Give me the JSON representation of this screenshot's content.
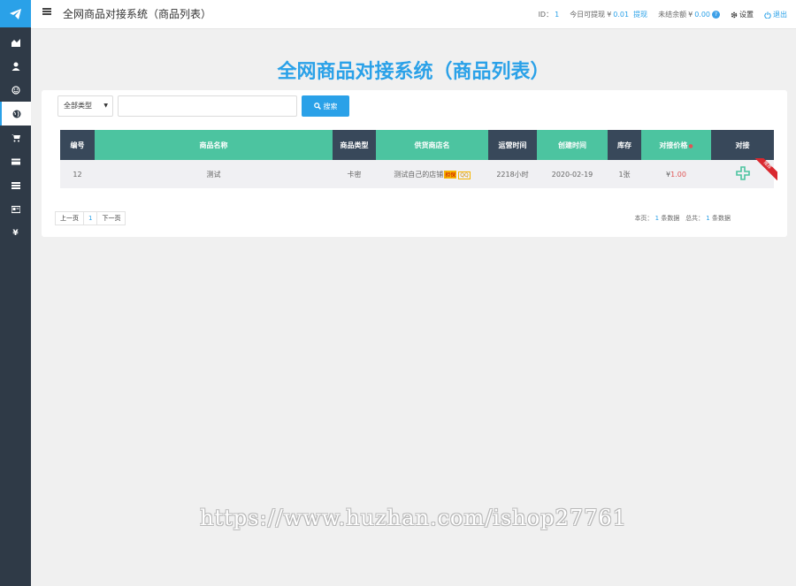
{
  "header": {
    "title": "全网商品对接系统（商品列表）",
    "id_label": "ID：",
    "id_value": "1",
    "withdraw_label": "今日可提现",
    "currency": "¥",
    "withdraw_value": "0.01",
    "withdraw_link": "提现",
    "unsettled_label": "未结余额",
    "unsettled_value": "0.00",
    "settings_label": "设置",
    "logout_label": "退出"
  },
  "sidebar": {
    "items": [
      {
        "icon": "chart-icon"
      },
      {
        "icon": "user-icon"
      },
      {
        "icon": "smile-icon"
      },
      {
        "icon": "globe-icon",
        "active": true
      },
      {
        "icon": "cart-icon"
      },
      {
        "icon": "card-icon"
      },
      {
        "icon": "list-icon"
      },
      {
        "icon": "id-card-icon"
      },
      {
        "icon": "yen-icon"
      }
    ]
  },
  "main": {
    "big_title": "全网商品对接系统（商品列表）",
    "filter": {
      "selected": "全部类型"
    },
    "search": {
      "value": "",
      "button_label": "搜索"
    },
    "table": {
      "headers": [
        "编号",
        "商品名称",
        "商品类型",
        "供货商店名",
        "运营时间",
        "创建时间",
        "库存",
        "对接价格",
        "对接"
      ],
      "rows": [
        {
          "id": "12",
          "name": "测试",
          "type": "卡密",
          "shop": "测试自己的店铺",
          "shop_badge": "担保",
          "shop_badge2": "QQ",
          "op_time": "2218小时",
          "created": "2020-02-19",
          "stock": "1张",
          "price_currency": "¥",
          "price": "1.00",
          "ribbon": "推荐"
        }
      ]
    },
    "pager": {
      "prev": "上一页",
      "current": "1",
      "next": "下一页"
    },
    "stats": {
      "page_label": "本页：",
      "page_count": "1",
      "page_unit": "条数据",
      "total_label": "总共：",
      "total_count": "1",
      "total_unit": "条数据"
    }
  },
  "watermark": "https://www.huzhan.com/ishop27761",
  "colors": {
    "accent": "#2aa1e8",
    "sidebar": "#2f3a47",
    "header_dark": "#38485a",
    "header_green": "#4cc4a0",
    "price": "#e05555"
  }
}
